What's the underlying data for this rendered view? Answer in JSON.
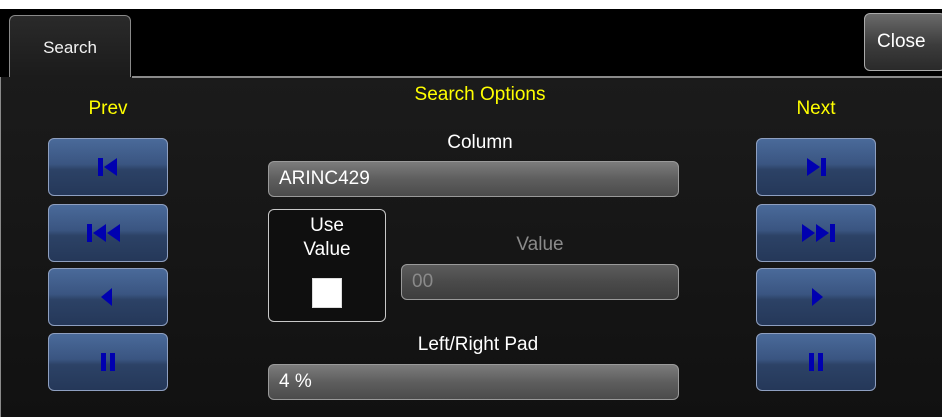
{
  "tab": {
    "label": "Search"
  },
  "close_button": {
    "label": "Close"
  },
  "section_title": "Search Options",
  "prev": {
    "label": "Prev",
    "buttons": [
      {
        "name": "first-icon"
      },
      {
        "name": "fast-back-icon"
      },
      {
        "name": "step-back-icon"
      },
      {
        "name": "pause-icon"
      }
    ]
  },
  "next": {
    "label": "Next",
    "buttons": [
      {
        "name": "last-icon"
      },
      {
        "name": "fast-forward-icon"
      },
      {
        "name": "step-forward-icon"
      },
      {
        "name": "pause-icon"
      }
    ]
  },
  "column": {
    "label": "Column",
    "value": "ARINC429"
  },
  "use_value": {
    "label_line1": "Use",
    "label_line2": "Value",
    "checked": false
  },
  "value": {
    "label": "Value",
    "value": "00"
  },
  "pad": {
    "label": "Left/Right Pad",
    "value": "4 %"
  },
  "colors": {
    "accent_label": "#ffff00",
    "nav_button": "#3a5581",
    "icon_fill": "#0000b0"
  }
}
